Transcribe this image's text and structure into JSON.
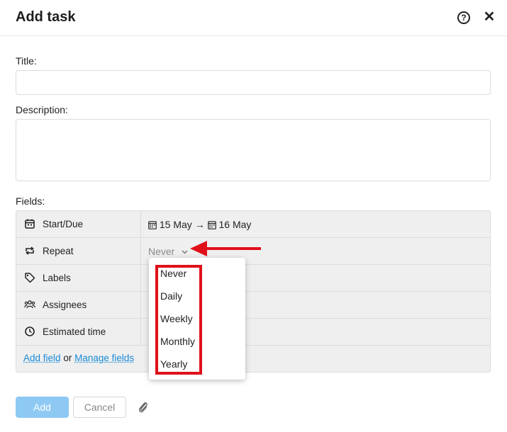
{
  "dialog": {
    "title": "Add task",
    "help_icon": "?",
    "close_icon": "✕"
  },
  "form": {
    "title_label": "Title:",
    "title_value": "",
    "description_label": "Description:",
    "description_value": "",
    "fields_label": "Fields:"
  },
  "fields": {
    "start_due": {
      "label": "Start/Due",
      "start": "15 May",
      "arrow": "→",
      "due": "16 May"
    },
    "repeat": {
      "label": "Repeat",
      "value": "Never"
    },
    "labels": {
      "label": "Labels"
    },
    "assignees": {
      "label": "Assignees"
    },
    "estimated_time": {
      "label": "Estimated time"
    },
    "add_field": "Add field",
    "or_text": "or",
    "manage_fields": "Manage fields"
  },
  "repeat_dropdown": {
    "options": [
      "Never",
      "Daily",
      "Weekly",
      "Monthly",
      "Yearly"
    ]
  },
  "buttons": {
    "add": "Add",
    "cancel": "Cancel"
  },
  "colors": {
    "accent": "#1a8ad6",
    "add_button": "#8ec9f3",
    "annotation_red": "#e0101a",
    "fields_bg": "#efefef"
  },
  "icons": [
    "help-icon",
    "close-icon",
    "calendar-icon",
    "repeat-icon",
    "tag-icon",
    "users-icon",
    "clock-icon",
    "chevron-down-icon",
    "paperclip-icon"
  ]
}
